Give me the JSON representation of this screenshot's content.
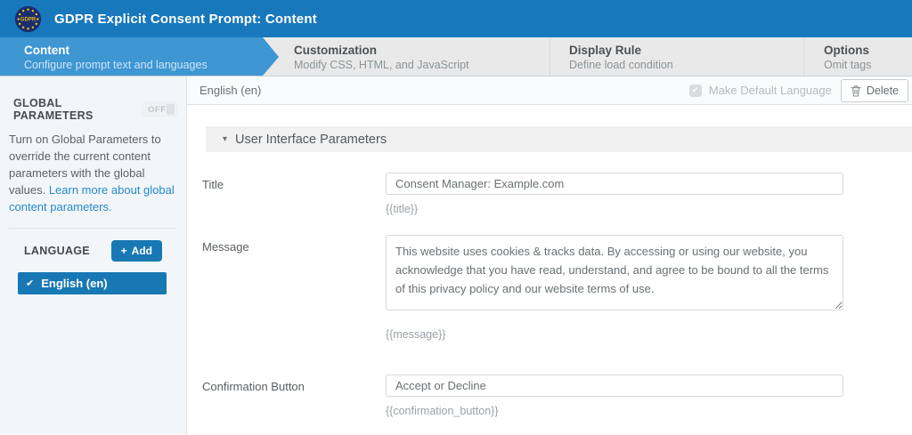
{
  "header": {
    "title": "GDPR Explicit Consent Prompt: Content",
    "logo_text": "GDPR"
  },
  "tabs": [
    {
      "label": "Content",
      "subtitle": "Configure prompt text and languages",
      "active": true
    },
    {
      "label": "Customization",
      "subtitle": "Modify CSS, HTML, and JavaScript",
      "active": false
    },
    {
      "label": "Display Rule",
      "subtitle": "Define load condition",
      "active": false
    },
    {
      "label": "Options",
      "subtitle": "Omit tags",
      "active": false
    }
  ],
  "sidebar": {
    "global_parameters": {
      "label": "GLOBAL PARAMETERS",
      "toggle_state": "OFF",
      "description": "Turn on Global Parameters to override the current content parameters with the global values. ",
      "link_text": "Learn more about global content parameters."
    },
    "language": {
      "label": "LANGUAGE",
      "add_button_label": "Add",
      "items": [
        {
          "label": "English (en)",
          "selected": true
        }
      ]
    }
  },
  "main": {
    "language_header": "English (en)",
    "make_default_label": "Make Default Language",
    "make_default_checked": true,
    "make_default_disabled": true,
    "delete_button_label": "Delete",
    "section_title": "User Interface Parameters",
    "fields": [
      {
        "label": "Title",
        "value": "Consent Manager: Example.com",
        "token": "{{title}}"
      },
      {
        "label": "Message",
        "value": "This website uses cookies & tracks data. By accessing or using our website, you acknowledge that you have read, understand, and agree to be bound to all the terms of this privacy policy and our website terms of use.",
        "token": "{{message}}"
      },
      {
        "label": "Confirmation Button",
        "value": "Accept or Decline",
        "token": "{{confirmation_button}}"
      }
    ]
  },
  "icons": {
    "plus": "+",
    "check": "✔",
    "caret_down": "▾"
  },
  "colors": {
    "header_bg": "#1878bc",
    "active_tab_bg": "#3e96d3",
    "primary_button_bg": "#1878b4",
    "link": "#2389cb",
    "sidebar_bg": "#f3f6f9",
    "tab_bg": "#e9e9e9",
    "section_header_bg": "#f1f1f1"
  }
}
